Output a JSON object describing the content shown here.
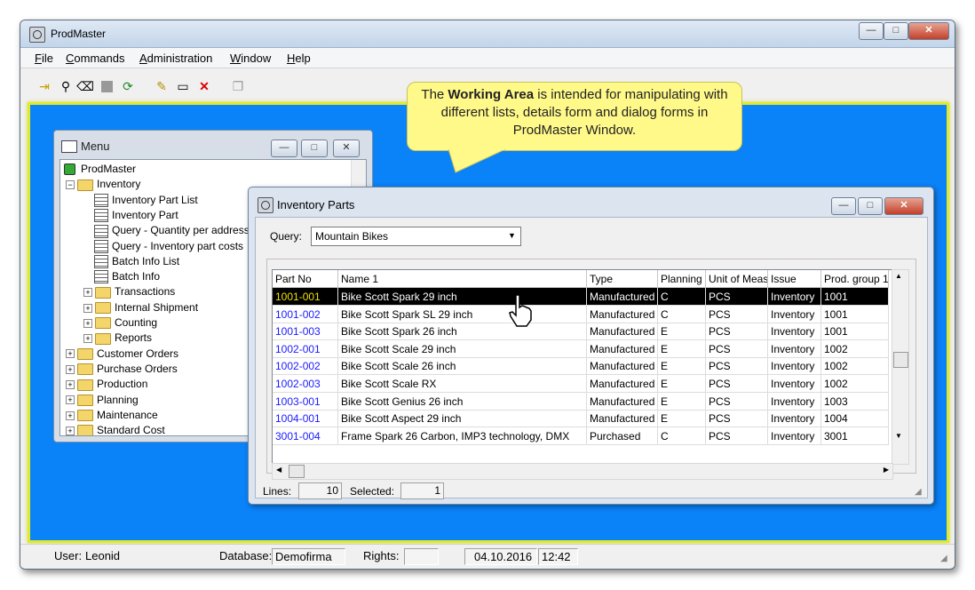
{
  "app": {
    "title": "ProdMaster",
    "window_controls": {
      "minimize": "—",
      "maximize": "□",
      "close": "✕"
    }
  },
  "menubar": {
    "items": [
      {
        "label": "File",
        "mnemonic": "F",
        "rest": "ile"
      },
      {
        "label": "Commands",
        "mnemonic": "C",
        "rest": "ommands"
      },
      {
        "label": "Administration",
        "mnemonic": "A",
        "rest": "dministration"
      },
      {
        "label": "Window",
        "mnemonic": "W",
        "rest": "indow"
      },
      {
        "label": "Help",
        "mnemonic": "H",
        "rest": "elp"
      }
    ]
  },
  "toolbar": {
    "icons": [
      "login-icon",
      "binoculars-icon",
      "eraser-icon",
      "stop-icon",
      "refresh-icon",
      "new-icon",
      "window-icon",
      "delete-icon",
      "copy-icon"
    ]
  },
  "callout": {
    "pre": "The ",
    "bold": "Working Area",
    "post": " is intended for manipulating with different lists, details form and dialog forms in ProdMaster Window."
  },
  "menu_window": {
    "title": "Menu",
    "tree": [
      {
        "label": "ProdMaster",
        "icon": "root-icon",
        "level": 0,
        "expander": ""
      },
      {
        "label": "Inventory",
        "icon": "folder-open-icon",
        "level": 1,
        "expander": "−"
      },
      {
        "label": "Inventory Part List",
        "icon": "list-icon",
        "level": 2,
        "expander": ""
      },
      {
        "label": "Inventory Part",
        "icon": "form-icon",
        "level": 2,
        "expander": ""
      },
      {
        "label": "Query - Quantity per address",
        "icon": "list-icon",
        "level": 2,
        "expander": ""
      },
      {
        "label": "Query - Inventory part costs",
        "icon": "list-icon",
        "level": 2,
        "expander": ""
      },
      {
        "label": "Batch Info List",
        "icon": "list-icon",
        "level": 2,
        "expander": ""
      },
      {
        "label": "Batch Info",
        "icon": "form-icon",
        "level": 2,
        "expander": ""
      },
      {
        "label": "Transactions",
        "icon": "folder-icon",
        "level": 2,
        "expander": "+"
      },
      {
        "label": "Internal Shipment",
        "icon": "folder-icon",
        "level": 2,
        "expander": "+"
      },
      {
        "label": "Counting",
        "icon": "folder-icon",
        "level": 2,
        "expander": "+"
      },
      {
        "label": "Reports",
        "icon": "folder-icon",
        "level": 2,
        "expander": "+"
      },
      {
        "label": "Customer Orders",
        "icon": "folder-icon",
        "level": 1,
        "expander": "+"
      },
      {
        "label": "Purchase Orders",
        "icon": "folder-icon",
        "level": 1,
        "expander": "+"
      },
      {
        "label": "Production",
        "icon": "folder-icon",
        "level": 1,
        "expander": "+"
      },
      {
        "label": "Planning",
        "icon": "folder-icon",
        "level": 1,
        "expander": "+"
      },
      {
        "label": "Maintenance",
        "icon": "folder-icon",
        "level": 1,
        "expander": "+"
      },
      {
        "label": "Standard Cost",
        "icon": "folder-icon",
        "level": 1,
        "expander": "+"
      }
    ]
  },
  "inventory_window": {
    "title": "Inventory Parts",
    "query_label": "Query:",
    "query_value": "Mountain Bikes",
    "columns": [
      "Part No",
      "Name 1",
      "Type",
      "Planning",
      "Unit of Meas",
      "Issue",
      "Prod. group 1"
    ],
    "rows": [
      [
        "1001-001",
        "Bike Scott Spark 29 inch",
        "Manufactured",
        "C",
        "PCS",
        "Inventory",
        "1001"
      ],
      [
        "1001-002",
        "Bike Scott Spark SL 29 inch",
        "Manufactured",
        "C",
        "PCS",
        "Inventory",
        "1001"
      ],
      [
        "1001-003",
        "Bike Scott Spark 26 inch",
        "Manufactured",
        "E",
        "PCS",
        "Inventory",
        "1001"
      ],
      [
        "1002-001",
        "Bike Scott Scale 29 inch",
        "Manufactured",
        "E",
        "PCS",
        "Inventory",
        "1002"
      ],
      [
        "1002-002",
        "Bike Scott Scale 26 inch",
        "Manufactured",
        "E",
        "PCS",
        "Inventory",
        "1002"
      ],
      [
        "1002-003",
        "Bike Scott Scale RX",
        "Manufactured",
        "E",
        "PCS",
        "Inventory",
        "1002"
      ],
      [
        "1003-001",
        "Bike Scott Genius 26 inch",
        "Manufactured",
        "E",
        "PCS",
        "Inventory",
        "1003"
      ],
      [
        "1004-001",
        "Bike Scott Aspect 29 inch",
        "Manufactured",
        "E",
        "PCS",
        "Inventory",
        "1004"
      ],
      [
        "3001-004",
        "Frame Spark 26 Carbon, IMP3 technology, DMX",
        "Purchased",
        "C",
        "PCS",
        "Inventory",
        "3001"
      ]
    ],
    "selected_row_index": 0,
    "lines_label": "Lines:",
    "lines_value": "10",
    "selected_label": "Selected:",
    "selected_value": "1"
  },
  "statusbar": {
    "user_label": "User:",
    "user_value": "Leonid",
    "database_label": "Database:",
    "database_value": "Demofirma",
    "rights_label": "Rights:",
    "rights_value": "",
    "date": "04.10.2016",
    "time": "12:42"
  },
  "colors": {
    "working_area": "#0a82f8",
    "working_area_border": "#e1ea2a",
    "callout": "#fff98a",
    "part_link": "#1a1aff",
    "selected_partno": "#f0e000"
  }
}
